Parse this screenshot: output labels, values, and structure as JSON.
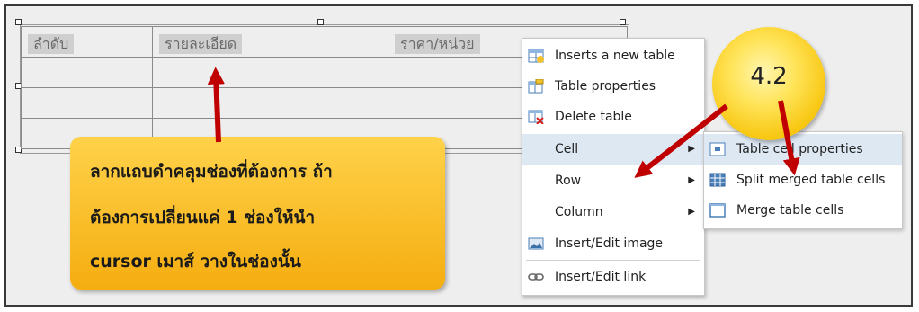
{
  "table": {
    "headers": [
      "ลำดับ",
      "รายละเอียด",
      "ราคา/หน่วย"
    ]
  },
  "context_menu": {
    "items": [
      {
        "label": "Inserts a new table",
        "icon": "insert-table-icon"
      },
      {
        "label": "Table properties",
        "icon": "table-properties-icon"
      },
      {
        "label": "Delete table",
        "icon": "delete-table-icon"
      },
      {
        "label": "Cell",
        "submenu": true
      },
      {
        "label": "Row",
        "submenu": true
      },
      {
        "label": "Column",
        "submenu": true
      },
      {
        "label": "Insert/Edit image",
        "icon": "image-icon"
      },
      {
        "label": "Insert/Edit link",
        "icon": "link-icon"
      }
    ],
    "submenu_arrow": "▶"
  },
  "cell_submenu": {
    "items": [
      {
        "label": "Table cell properties",
        "icon": "cell-properties-icon"
      },
      {
        "label": "Split merged table cells",
        "icon": "split-cells-icon"
      },
      {
        "label": "Merge table cells",
        "icon": "merge-cells-icon"
      }
    ]
  },
  "callout": {
    "lines": [
      "ลากแถบดำคลุมช่องที่ต้องการ ถ้า",
      "ต้องการเปลี่ยนแค่ 1 ช่องให้นำ",
      "cursor เมาส์ วางในช่องนั้น"
    ]
  },
  "step_bubble": {
    "label": "4.2"
  },
  "colors": {
    "arrow": "#c00000",
    "callout": "#f7b515",
    "menu_highlight": "#dde8f3"
  }
}
